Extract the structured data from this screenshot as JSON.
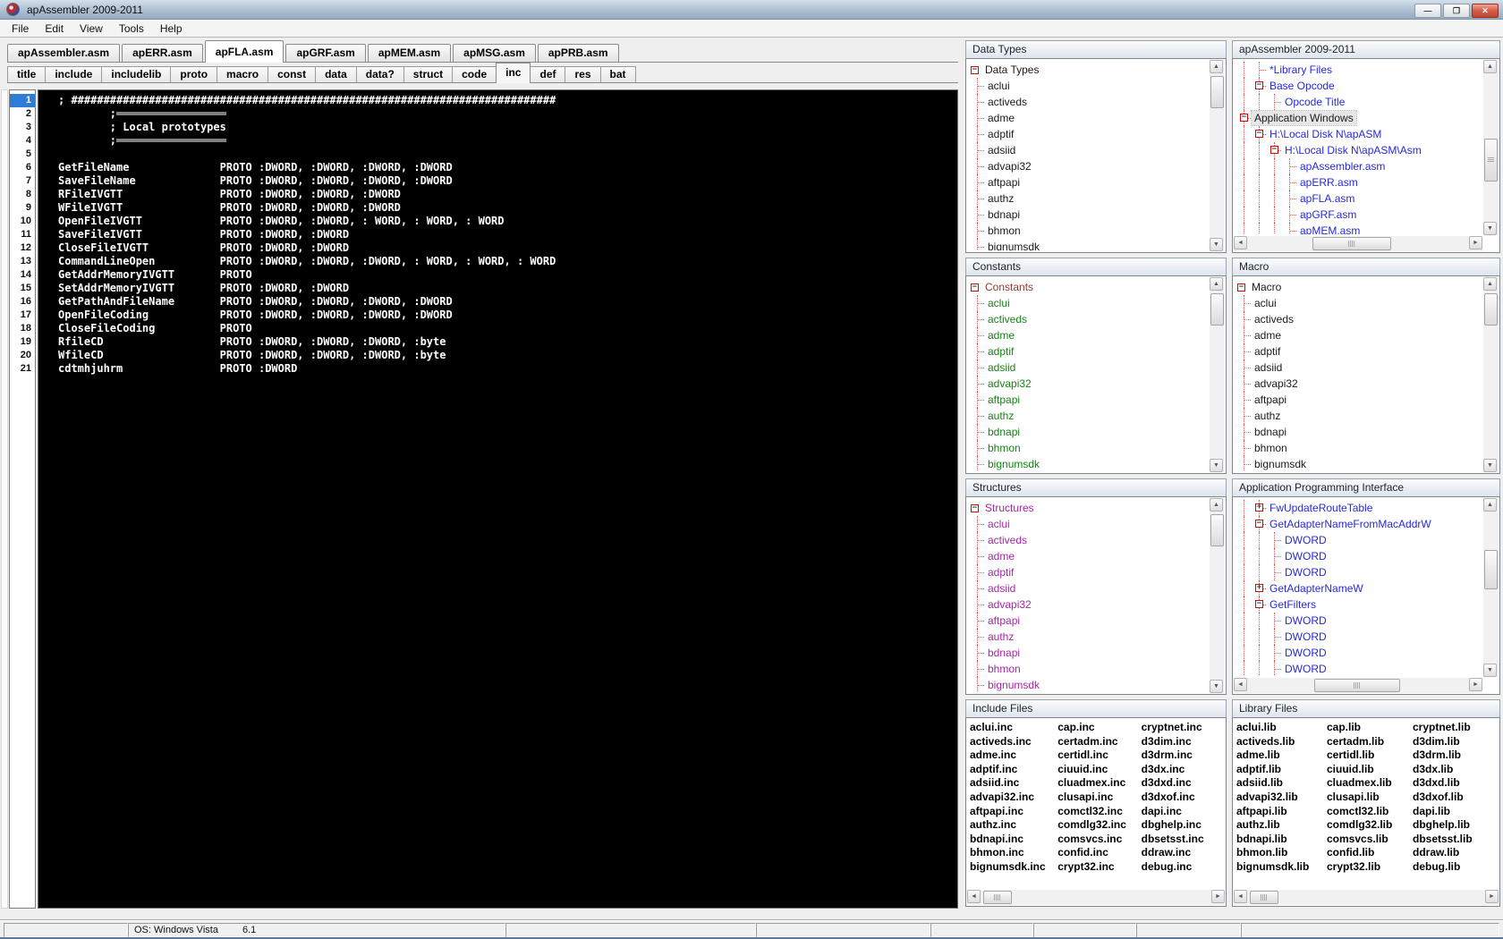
{
  "window": {
    "title": "apAssembler 2009-2011"
  },
  "titlebar_buttons": {
    "minimize": "—",
    "restore": "❐",
    "close": "✕"
  },
  "menu": [
    "File",
    "Edit",
    "View",
    "Tools",
    "Help"
  ],
  "file_tabs": {
    "items": [
      "apAssembler.asm",
      "apERR.asm",
      "apFLA.asm",
      "apGRF.asm",
      "apMEM.asm",
      "apMSG.asm",
      "apPRB.asm"
    ],
    "active": "apFLA.asm"
  },
  "section_tabs": {
    "items": [
      "title",
      "include",
      "includelib",
      "proto",
      "macro",
      "const",
      "data",
      "data?",
      "struct",
      "code",
      "inc",
      "def",
      "res",
      "bat"
    ],
    "active": "inc"
  },
  "editor": {
    "selected_line": 1,
    "lines": [
      {
        "n": 1,
        "text": "; ###########################################################################"
      },
      {
        "n": 2,
        "text": "        ;═════════════════"
      },
      {
        "n": 3,
        "text": "        ; Local prototypes"
      },
      {
        "n": 4,
        "text": "        ;═════════════════"
      },
      {
        "n": 5,
        "text": ""
      },
      {
        "n": 6,
        "name": "GetFileName",
        "args": "PROTO :DWORD, :DWORD, :DWORD, :DWORD"
      },
      {
        "n": 7,
        "name": "SaveFileName",
        "args": "PROTO :DWORD, :DWORD, :DWORD, :DWORD"
      },
      {
        "n": 8,
        "name": "RFileIVGTT",
        "args": "PROTO :DWORD, :DWORD, :DWORD"
      },
      {
        "n": 9,
        "name": "WFileIVGTT",
        "args": "PROTO :DWORD, :DWORD, :DWORD"
      },
      {
        "n": 10,
        "name": "OpenFileIVGTT",
        "args": "PROTO :DWORD, :DWORD, : WORD, : WORD, : WORD"
      },
      {
        "n": 11,
        "name": "SaveFileIVGTT",
        "args": "PROTO :DWORD, :DWORD"
      },
      {
        "n": 12,
        "name": "CloseFileIVGTT",
        "args": "PROTO :DWORD, :DWORD"
      },
      {
        "n": 13,
        "name": "CommandLineOpen",
        "args": "PROTO :DWORD, :DWORD, :DWORD, : WORD, : WORD, : WORD"
      },
      {
        "n": 14,
        "name": "GetAddrMemoryIVGTT",
        "args": "PROTO"
      },
      {
        "n": 15,
        "name": "SetAddrMemoryIVGTT",
        "args": "PROTO :DWORD, :DWORD"
      },
      {
        "n": 16,
        "name": "GetPathAndFileName",
        "args": "PROTO :DWORD, :DWORD, :DWORD, :DWORD"
      },
      {
        "n": 17,
        "name": "OpenFileCoding",
        "args": "PROTO :DWORD, :DWORD, :DWORD, :DWORD"
      },
      {
        "n": 18,
        "name": "CloseFileCoding",
        "args": "PROTO"
      },
      {
        "n": 19,
        "name": "RfileCD",
        "args": "PROTO :DWORD, :DWORD, :DWORD, :byte"
      },
      {
        "n": 20,
        "name": "WfileCD",
        "args": "PROTO :DWORD, :DWORD, :DWORD, :byte"
      },
      {
        "n": 21,
        "name": "cdtmhjuhrm",
        "args": "PROTO :DWORD"
      }
    ]
  },
  "panels": {
    "data_types": {
      "title": "Data Types",
      "item_color": "#1A1A1A",
      "tree": [
        {
          "t": "Data Types",
          "d": 0,
          "b": "-"
        },
        {
          "t": "aclui",
          "d": 1
        },
        {
          "t": "activeds",
          "d": 1
        },
        {
          "t": "adme",
          "d": 1
        },
        {
          "t": "adptif",
          "d": 1
        },
        {
          "t": "adsiid",
          "d": 1
        },
        {
          "t": "advapi32",
          "d": 1
        },
        {
          "t": "aftpapi",
          "d": 1
        },
        {
          "t": "authz",
          "d": 1
        },
        {
          "t": "bdnapi",
          "d": 1
        },
        {
          "t": "bhmon",
          "d": 1
        },
        {
          "t": "bignumsdk",
          "d": 1
        }
      ]
    },
    "ap_tree": {
      "title": "apAssembler 2009-2011",
      "item_color": "#2828DC",
      "tree": [
        {
          "t": "*Library Files",
          "d": 2
        },
        {
          "t": "Base Opcode",
          "d": 2,
          "b": "-"
        },
        {
          "t": "Opcode Title",
          "d": 3
        },
        {
          "t": "Application Windows",
          "d": 1,
          "b": "-",
          "c": "#1A1A1A",
          "sel": true
        },
        {
          "t": "H:\\Local Disk N\\apASM",
          "d": 2,
          "b": "-"
        },
        {
          "t": "H:\\Local Disk N\\apASM\\Asm",
          "d": 3,
          "b": "-"
        },
        {
          "t": "apAssembler.asm",
          "d": 4
        },
        {
          "t": "apERR.asm",
          "d": 4
        },
        {
          "t": "apFLA.asm",
          "d": 4
        },
        {
          "t": "apGRF.asm",
          "d": 4
        },
        {
          "t": "apMEM.asm",
          "d": 4
        }
      ]
    },
    "constants": {
      "title": "Constants",
      "item_color": "#188018",
      "tree": [
        {
          "t": "Constants",
          "d": 0,
          "b": "-",
          "c": "#8B3A2E"
        },
        {
          "t": "aclui",
          "d": 1
        },
        {
          "t": "activeds",
          "d": 1
        },
        {
          "t": "adme",
          "d": 1
        },
        {
          "t": "adptif",
          "d": 1
        },
        {
          "t": "adsiid",
          "d": 1
        },
        {
          "t": "advapi32",
          "d": 1
        },
        {
          "t": "aftpapi",
          "d": 1
        },
        {
          "t": "authz",
          "d": 1
        },
        {
          "t": "bdnapi",
          "d": 1
        },
        {
          "t": "bhmon",
          "d": 1
        },
        {
          "t": "bignumsdk",
          "d": 1
        }
      ]
    },
    "macro": {
      "title": "Macro",
      "item_color": "#1A1A1A",
      "tree": [
        {
          "t": "Macro",
          "d": 0,
          "b": "-"
        },
        {
          "t": "aclui",
          "d": 1
        },
        {
          "t": "activeds",
          "d": 1
        },
        {
          "t": "adme",
          "d": 1
        },
        {
          "t": "adptif",
          "d": 1
        },
        {
          "t": "adsiid",
          "d": 1
        },
        {
          "t": "advapi32",
          "d": 1
        },
        {
          "t": "aftpapi",
          "d": 1
        },
        {
          "t": "authz",
          "d": 1
        },
        {
          "t": "bdnapi",
          "d": 1
        },
        {
          "t": "bhmon",
          "d": 1
        },
        {
          "t": "bignumsdk",
          "d": 1
        }
      ]
    },
    "structures": {
      "title": "Structures",
      "item_color": "#A428A4",
      "tree": [
        {
          "t": "Structures",
          "d": 0,
          "b": "-"
        },
        {
          "t": "aclui",
          "d": 1
        },
        {
          "t": "activeds",
          "d": 1
        },
        {
          "t": "adme",
          "d": 1
        },
        {
          "t": "adptif",
          "d": 1
        },
        {
          "t": "adsiid",
          "d": 1
        },
        {
          "t": "advapi32",
          "d": 1
        },
        {
          "t": "aftpapi",
          "d": 1
        },
        {
          "t": "authz",
          "d": 1
        },
        {
          "t": "bdnapi",
          "d": 1
        },
        {
          "t": "bhmon",
          "d": 1
        },
        {
          "t": "bignumsdk",
          "d": 1
        }
      ]
    },
    "api": {
      "title": "Application Programming Interface",
      "item_color": "#2828DC",
      "tree": [
        {
          "t": "FwUpdateRouteTable",
          "d": 2,
          "b": "+"
        },
        {
          "t": "GetAdapterNameFromMacAddrW",
          "d": 2,
          "b": "-"
        },
        {
          "t": "DWORD",
          "d": 3
        },
        {
          "t": "DWORD",
          "d": 3
        },
        {
          "t": "DWORD",
          "d": 3
        },
        {
          "t": "GetAdapterNameW",
          "d": 2,
          "b": "+"
        },
        {
          "t": "GetFilters",
          "d": 2,
          "b": "-"
        },
        {
          "t": "DWORD",
          "d": 3
        },
        {
          "t": "DWORD",
          "d": 3
        },
        {
          "t": "DWORD",
          "d": 3
        },
        {
          "t": "DWORD",
          "d": 3
        }
      ]
    },
    "include_files": {
      "title": "Include Files",
      "columns": [
        [
          "aclui.inc",
          "activeds.inc",
          "adme.inc",
          "adptif.inc",
          "adsiid.inc",
          "advapi32.inc",
          "aftpapi.inc",
          "authz.inc",
          "bdnapi.inc",
          "bhmon.inc",
          "bignumsdk.inc"
        ],
        [
          "cap.inc",
          "certadm.inc",
          "certidl.inc",
          "ciuuid.inc",
          "cluadmex.inc",
          "clusapi.inc",
          "comctl32.inc",
          "comdlg32.inc",
          "comsvcs.inc",
          "confid.inc",
          "crypt32.inc"
        ],
        [
          "cryptnet.inc",
          "d3dim.inc",
          "d3drm.inc",
          "d3dx.inc",
          "d3dxd.inc",
          "d3dxof.inc",
          "dapi.inc",
          "dbghelp.inc",
          "dbsetsst.inc",
          "ddraw.inc",
          "debug.inc"
        ]
      ]
    },
    "library_files": {
      "title": "Library Files",
      "columns": [
        [
          "aclui.lib",
          "activeds.lib",
          "adme.lib",
          "adptif.lib",
          "adsiid.lib",
          "advapi32.lib",
          "aftpapi.lib",
          "authz.lib",
          "bdnapi.lib",
          "bhmon.lib",
          "bignumsdk.lib"
        ],
        [
          "cap.lib",
          "certadm.lib",
          "certidl.lib",
          "ciuuid.lib",
          "cluadmex.lib",
          "clusapi.lib",
          "comctl32.lib",
          "comdlg32.lib",
          "comsvcs.lib",
          "confid.lib",
          "crypt32.lib"
        ],
        [
          "cryptnet.lib",
          "d3dim.lib",
          "d3drm.lib",
          "d3dx.lib",
          "d3dxd.lib",
          "d3dxof.lib",
          "dapi.lib",
          "dbghelp.lib",
          "dbsetsst.lib",
          "ddraw.lib",
          "debug.lib"
        ]
      ]
    }
  },
  "status_bar": {
    "os_label": "OS: Windows Vista",
    "os_version": "6.1"
  },
  "colors": {
    "tree_guide": "#E05858",
    "tree_box_border": "#E00000",
    "blue_item": "#2828DC",
    "green_item": "#188018",
    "purple_item": "#A428A4",
    "brown_root": "#8B3A2E",
    "black_item": "#1A1A1A",
    "gutter_selected": "#2E7CD6",
    "close_button": "#C94A33",
    "editor_bg": "#000000",
    "editor_text": "#FFFFFF"
  }
}
